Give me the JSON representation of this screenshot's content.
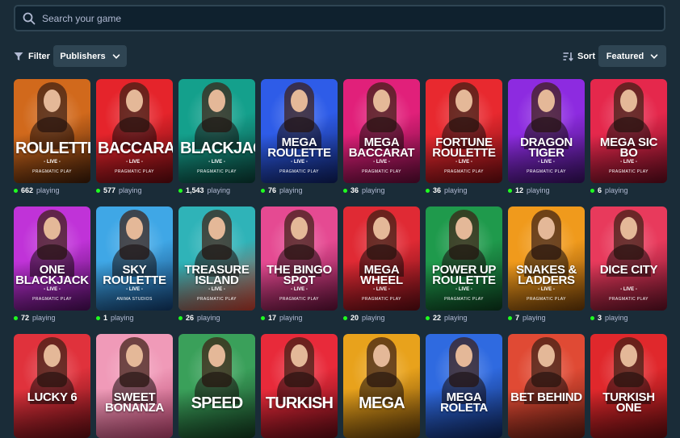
{
  "search": {
    "placeholder": "Search your game"
  },
  "toolbar": {
    "filter_label": "Filter",
    "publishers_label": "Publishers",
    "sort_label": "Sort",
    "featured_label": "Featured"
  },
  "colors": {
    "background": "#1a2c38",
    "input_bg": "#0f212e",
    "pill_bg": "#2f4553",
    "muted_text": "#b1bad3",
    "online_dot": "#1fff20"
  },
  "playing_suffix": "playing",
  "games": [
    {
      "title": "ROULETTE",
      "sub": "- LIVE -",
      "publisher": "PRAGMATIC PLAY",
      "players": "662",
      "bg": "#d1691c",
      "bg2": "#3b1b08"
    },
    {
      "title": "BACCARAT",
      "sub": "- LIVE -",
      "publisher": "PRAGMATIC PLAY",
      "players": "577",
      "bg": "#e5242b",
      "bg2": "#5e0a0f"
    },
    {
      "title": "BLACKJACK",
      "sub": "- LIVE -",
      "publisher": "PRAGMATIC PLAY",
      "players": "1,543",
      "bg": "#14a08c",
      "bg2": "#0a3b34"
    },
    {
      "title": "MEGA ROULETTE",
      "sub": "- LIVE -",
      "publisher": "PRAGMATIC PLAY",
      "players": "76",
      "bg": "#2e5ce8",
      "bg2": "#0e1e5c"
    },
    {
      "title": "MEGA BACCARAT",
      "sub": "- LIVE -",
      "publisher": "PRAGMATIC PLAY",
      "players": "36",
      "bg": "#e1207a",
      "bg2": "#5e0b35"
    },
    {
      "title": "FORTUNE ROULETTE",
      "sub": "- LIVE -",
      "publisher": "PRAGMATIC PLAY",
      "players": "36",
      "bg": "#e8292f",
      "bg2": "#6a0c10"
    },
    {
      "title": "DRAGON TIGER",
      "sub": "- LIVE -",
      "publisher": "PRAGMATIC PLAY",
      "players": "12",
      "bg": "#8d2be0",
      "bg2": "#35105c"
    },
    {
      "title": "MEGA SIC BO",
      "sub": "- LIVE -",
      "publisher": "PRAGMATIC PLAY",
      "players": "6",
      "bg": "#e5284c",
      "bg2": "#5e0b1c"
    },
    {
      "title": "ONE BLACKJACK",
      "sub": "- LIVE -",
      "publisher": "PRAGMATIC PLAY",
      "players": "72",
      "bg": "#c033d8",
      "bg2": "#4a0d58"
    },
    {
      "title": "SKY ROULETTE",
      "sub": "- LIVE -",
      "publisher": "ANIMA STUDIOS",
      "players": "1",
      "bg": "#3fa7e6",
      "bg2": "#123a6a"
    },
    {
      "title": "TREASURE ISLAND",
      "sub": "- LIVE -",
      "publisher": "PRAGMATIC PLAY",
      "players": "26",
      "bg": "#2fb3b8",
      "bg2": "#c23a2a"
    },
    {
      "title": "THE BINGO SPOT",
      "sub": "- LIVE -",
      "publisher": "PRAGMATIC PLAY",
      "players": "17",
      "bg": "#e54a92",
      "bg2": "#5e1036"
    },
    {
      "title": "MEGA WHEEL",
      "sub": "- LIVE -",
      "publisher": "PRAGMATIC PLAY",
      "players": "20",
      "bg": "#e02a34",
      "bg2": "#5c0c12"
    },
    {
      "title": "POWER UP ROULETTE",
      "sub": "- LIVE -",
      "publisher": "PRAGMATIC PLAY",
      "players": "22",
      "bg": "#1f9a4c",
      "bg2": "#0c3a1d"
    },
    {
      "title": "SNAKES & LADDERS",
      "sub": "- LIVE -",
      "publisher": "PRAGMATIC PLAY",
      "players": "7",
      "bg": "#f09a1c",
      "bg2": "#6a3a08"
    },
    {
      "title": "DICE CITY",
      "sub": "- LIVE -",
      "publisher": "PRAGMATIC PLAY",
      "players": "3",
      "bg": "#e83a5c",
      "bg2": "#5e1024"
    },
    {
      "title": "LUCKY 6",
      "sub": "",
      "publisher": "",
      "players": "",
      "bg": "#e0323c",
      "bg2": "#5e0c12"
    },
    {
      "title": "SWEET BONANZA",
      "sub": "",
      "publisher": "",
      "players": "",
      "bg": "#f09ab8",
      "bg2": "#b3406a"
    },
    {
      "title": "SPEED",
      "sub": "",
      "publisher": "",
      "players": "",
      "bg": "#3aa05a",
      "bg2": "#14391f"
    },
    {
      "title": "TURKISH",
      "sub": "",
      "publisher": "",
      "players": "",
      "bg": "#e82a3a",
      "bg2": "#5e0b14"
    },
    {
      "title": "MEGA",
      "sub": "",
      "publisher": "",
      "players": "",
      "bg": "#e8a21c",
      "bg2": "#5e3a08"
    },
    {
      "title": "MEGA ROLETA",
      "sub": "",
      "publisher": "",
      "players": "",
      "bg": "#2f6ae0",
      "bg2": "#0e2458"
    },
    {
      "title": "BET BEHIND",
      "sub": "",
      "publisher": "",
      "players": "",
      "bg": "#e04a34",
      "bg2": "#5e1a10"
    },
    {
      "title": "TURKISH ONE",
      "sub": "",
      "publisher": "",
      "players": "",
      "bg": "#e0282c",
      "bg2": "#5e0c0e"
    }
  ]
}
